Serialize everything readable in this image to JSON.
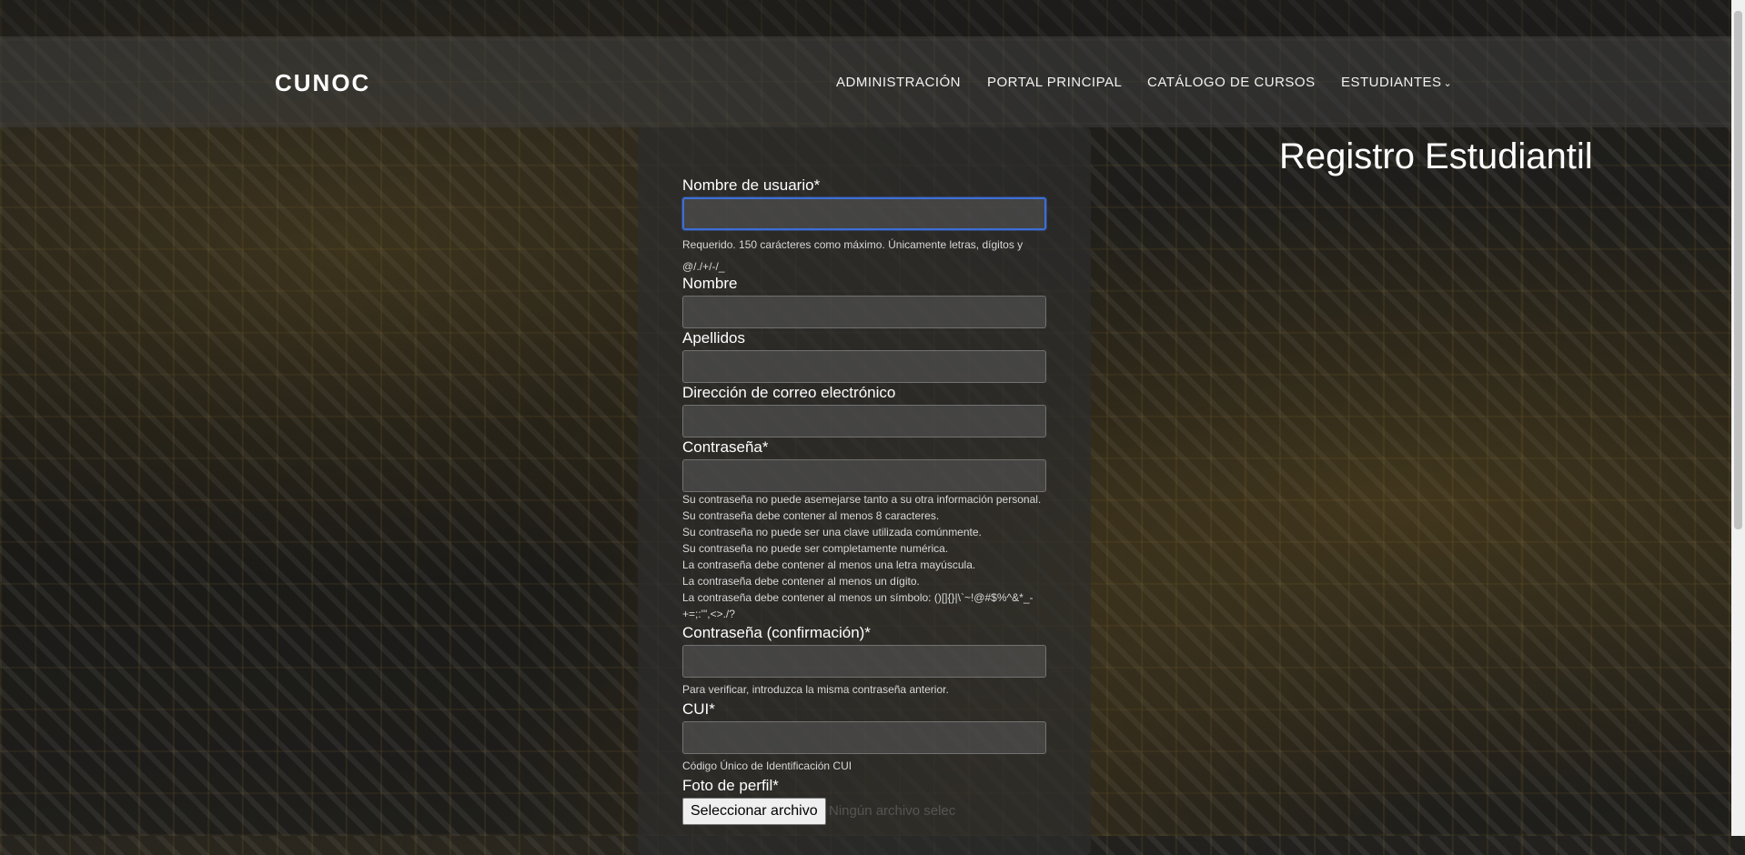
{
  "header": {
    "brand": "CUNOC",
    "nav": [
      {
        "label": "ADMINISTRACIÓN"
      },
      {
        "label": "PORTAL PRINCIPAL"
      },
      {
        "label": "CATÁLOGO DE CURSOS"
      },
      {
        "label": "ESTUDIANTES",
        "chevron": "chevron-down-icon"
      }
    ]
  },
  "page": {
    "title": "Registro Estudiantil"
  },
  "form": {
    "username": {
      "label": "Nombre de usuario*",
      "value": "",
      "help": "Requerido. 150 carácteres como máximo. Únicamente letras, dígitos y @/./+/-/_"
    },
    "first_name": {
      "label": "Nombre",
      "value": ""
    },
    "last_name": {
      "label": "Apellidos",
      "value": ""
    },
    "email": {
      "label": "Dirección de correo electrónico",
      "value": ""
    },
    "password": {
      "label": "Contraseña*",
      "value": "",
      "help": [
        "Su contraseña no puede asemejarse tanto a su otra información personal.",
        "Su contraseña debe contener al menos 8 caracteres.",
        "Su contraseña no puede ser una clave utilizada comúnmente.",
        "Su contraseña no puede ser completamente numérica.",
        "La contraseña debe contener al menos una letra mayúscula.",
        "La contraseña debe contener al menos un dígito.",
        "La contraseña debe contener al menos un símbolo: ()[]{}|\\`~!@#$%^&*_-+=;:'\",<>./?"
      ]
    },
    "password_confirm": {
      "label": "Contraseña (confirmación)*",
      "value": "",
      "help": "Para verificar, introduzca la misma contraseña anterior."
    },
    "cui": {
      "label": "CUI*",
      "value": "",
      "help": "Código Único de Identificación CUI"
    },
    "photo": {
      "label": "Foto de perfil*",
      "button": "Seleccionar archivo",
      "status": "Ningún archivo selec"
    }
  },
  "colors": {
    "accent_focus": "#3d6fd6",
    "panel": "#2d2d2d",
    "gold": "#b8922f"
  }
}
